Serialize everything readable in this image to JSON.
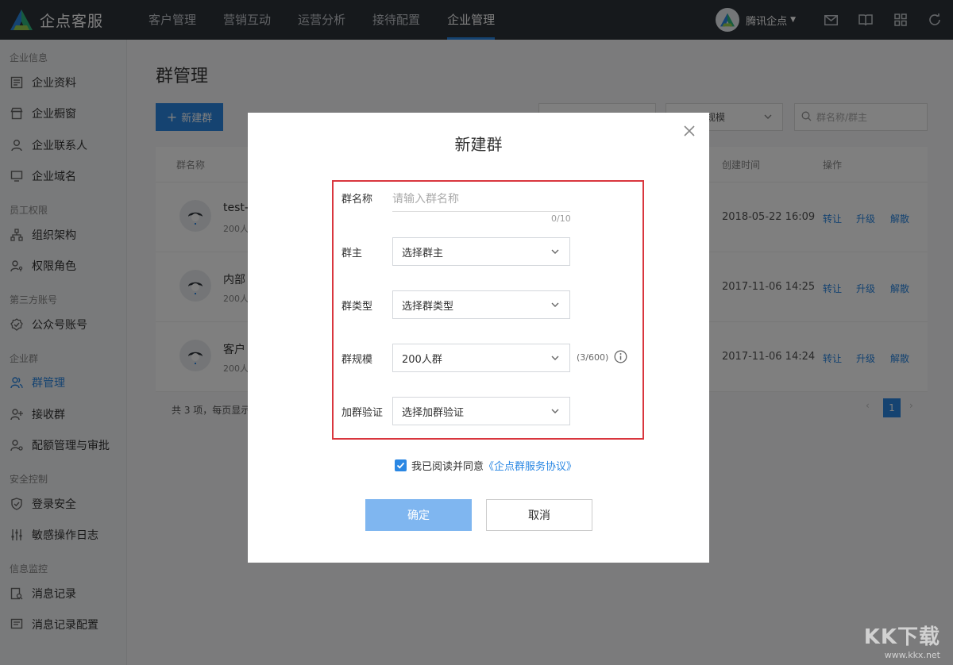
{
  "brand": {
    "name": "企点客服"
  },
  "topnav": {
    "items": [
      "客户管理",
      "营销互动",
      "运营分析",
      "接待配置",
      "企业管理"
    ],
    "active_index": 4
  },
  "account": {
    "name": "腾讯企点"
  },
  "sidebar": {
    "groups": [
      {
        "title": "企业信息",
        "items": [
          "企业资料",
          "企业橱窗",
          "企业联系人",
          "企业域名"
        ]
      },
      {
        "title": "员工权限",
        "items": [
          "组织架构",
          "权限角色"
        ]
      },
      {
        "title": "第三方账号",
        "items": [
          "公众号账号"
        ]
      },
      {
        "title": "企业群",
        "items": [
          "群管理",
          "接收群",
          "配额管理与审批"
        ]
      },
      {
        "title": "安全控制",
        "items": [
          "登录安全",
          "敏感操作日志"
        ]
      },
      {
        "title": "信息监控",
        "items": [
          "消息记录",
          "消息记录配置"
        ]
      }
    ],
    "active_item": "群管理"
  },
  "page": {
    "title": "群管理",
    "new_button": "新建群",
    "filter_partial": "规模",
    "search_placeholder": "群名称/群主",
    "columns": {
      "name": "群名称",
      "created": "创建时间",
      "actions": "操作"
    },
    "rows": [
      {
        "name": "test-",
        "sub": "200人",
        "created": "2018-05-22 16:09"
      },
      {
        "name": "内部",
        "sub": "200人",
        "created": "2017-11-06 14:25"
      },
      {
        "name": "客户",
        "sub": "200人",
        "created": "2017-11-06 14:24"
      }
    ],
    "row_actions": [
      "转让",
      "升级",
      "解散"
    ],
    "footer": "共 3 项，每页显示",
    "current_page": "1"
  },
  "modal": {
    "title": "新建群",
    "fields": {
      "name_label": "群名称",
      "name_placeholder": "请输入群名称",
      "name_count": "0/10",
      "owner_label": "群主",
      "owner_value": "选择群主",
      "type_label": "群类型",
      "type_value": "选择群类型",
      "scale_label": "群规模",
      "scale_value": "200人群",
      "scale_quota": "(3/600)",
      "verify_label": "加群验证",
      "verify_value": "选择加群验证"
    },
    "agree_text": "我已阅读并同意",
    "agree_link": "《企点群服务协议》",
    "agree_checked": true,
    "confirm_label": "确定",
    "cancel_label": "取消"
  },
  "watermark": {
    "big": "KK下载",
    "url": "www.kkx.net"
  },
  "colors": {
    "accent": "#2a87e3",
    "topbar": "#2d3238",
    "highlight_border": "#d9363e",
    "confirm_disabled": "#7fb6f0"
  }
}
